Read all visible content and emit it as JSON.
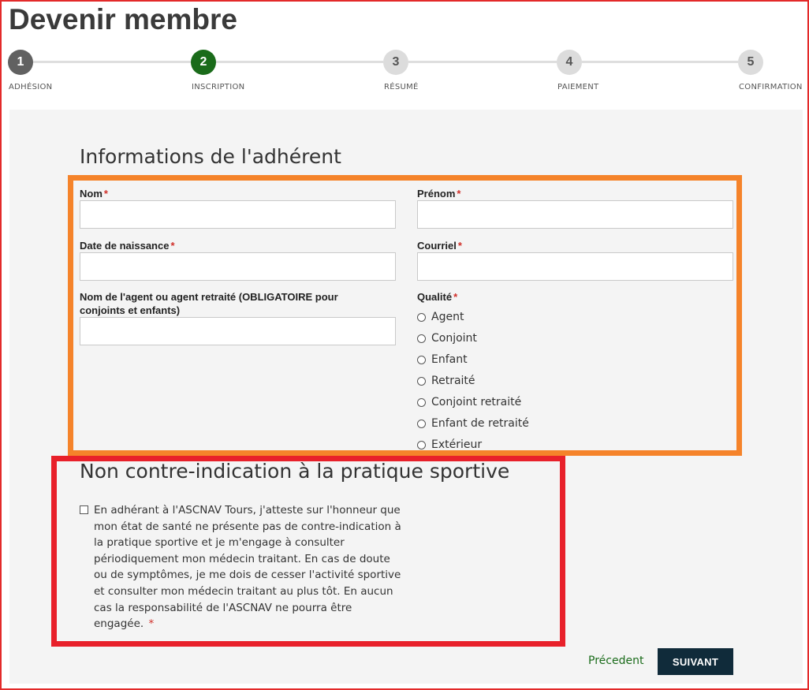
{
  "page": {
    "title": "Devenir membre"
  },
  "stepper": {
    "steps": [
      {
        "number": "1",
        "label": "ADHÉSION",
        "state": "done"
      },
      {
        "number": "2",
        "label": "INSCRIPTION",
        "state": "active"
      },
      {
        "number": "3",
        "label": "RÉSUMÉ",
        "state": "todo"
      },
      {
        "number": "4",
        "label": "PAIEMENT",
        "state": "todo"
      },
      {
        "number": "5",
        "label": "CONFIRMATION",
        "state": "todo"
      }
    ]
  },
  "member_info": {
    "title": "Informations de l'adhérent",
    "required_mark": "*",
    "fields": {
      "nom": {
        "label": "Nom",
        "value": ""
      },
      "prenom": {
        "label": "Prénom",
        "value": ""
      },
      "date_naissance": {
        "label": "Date de naissance",
        "value": ""
      },
      "courriel": {
        "label": "Courriel",
        "value": ""
      },
      "agent": {
        "label": "Nom de l'agent ou agent retraité (OBLIGATOIRE pour conjoints et enfants)",
        "value": ""
      }
    },
    "qualite": {
      "label": "Qualité",
      "options": [
        "Agent",
        "Conjoint",
        "Enfant",
        "Retraité",
        "Conjoint retraité",
        "Enfant de retraité",
        "Extérieur"
      ]
    }
  },
  "health": {
    "title": "Non contre-indication à la pratique sportive",
    "attestation": "En adhérant à l'ASCNAV Tours, j'atteste sur l'honneur que mon état de santé ne présente pas de contre-indication à la pratique sportive et je m'engage à consulter périodiquement mon médecin traitant. En cas de doute ou de symptômes, je me dois de cesser l'activité sportive et consulter mon médecin traitant au plus tôt. En aucun cas la responsabilité de l'ASCNAV ne pourra être engagée.",
    "checked": false
  },
  "nav": {
    "previous": "Précedent",
    "next": "SUIVANT"
  },
  "colors": {
    "accent_green": "#1a6b1a",
    "button_dark": "#102b3a",
    "highlight_orange": "#f5832a",
    "highlight_red": "#e8202a"
  }
}
